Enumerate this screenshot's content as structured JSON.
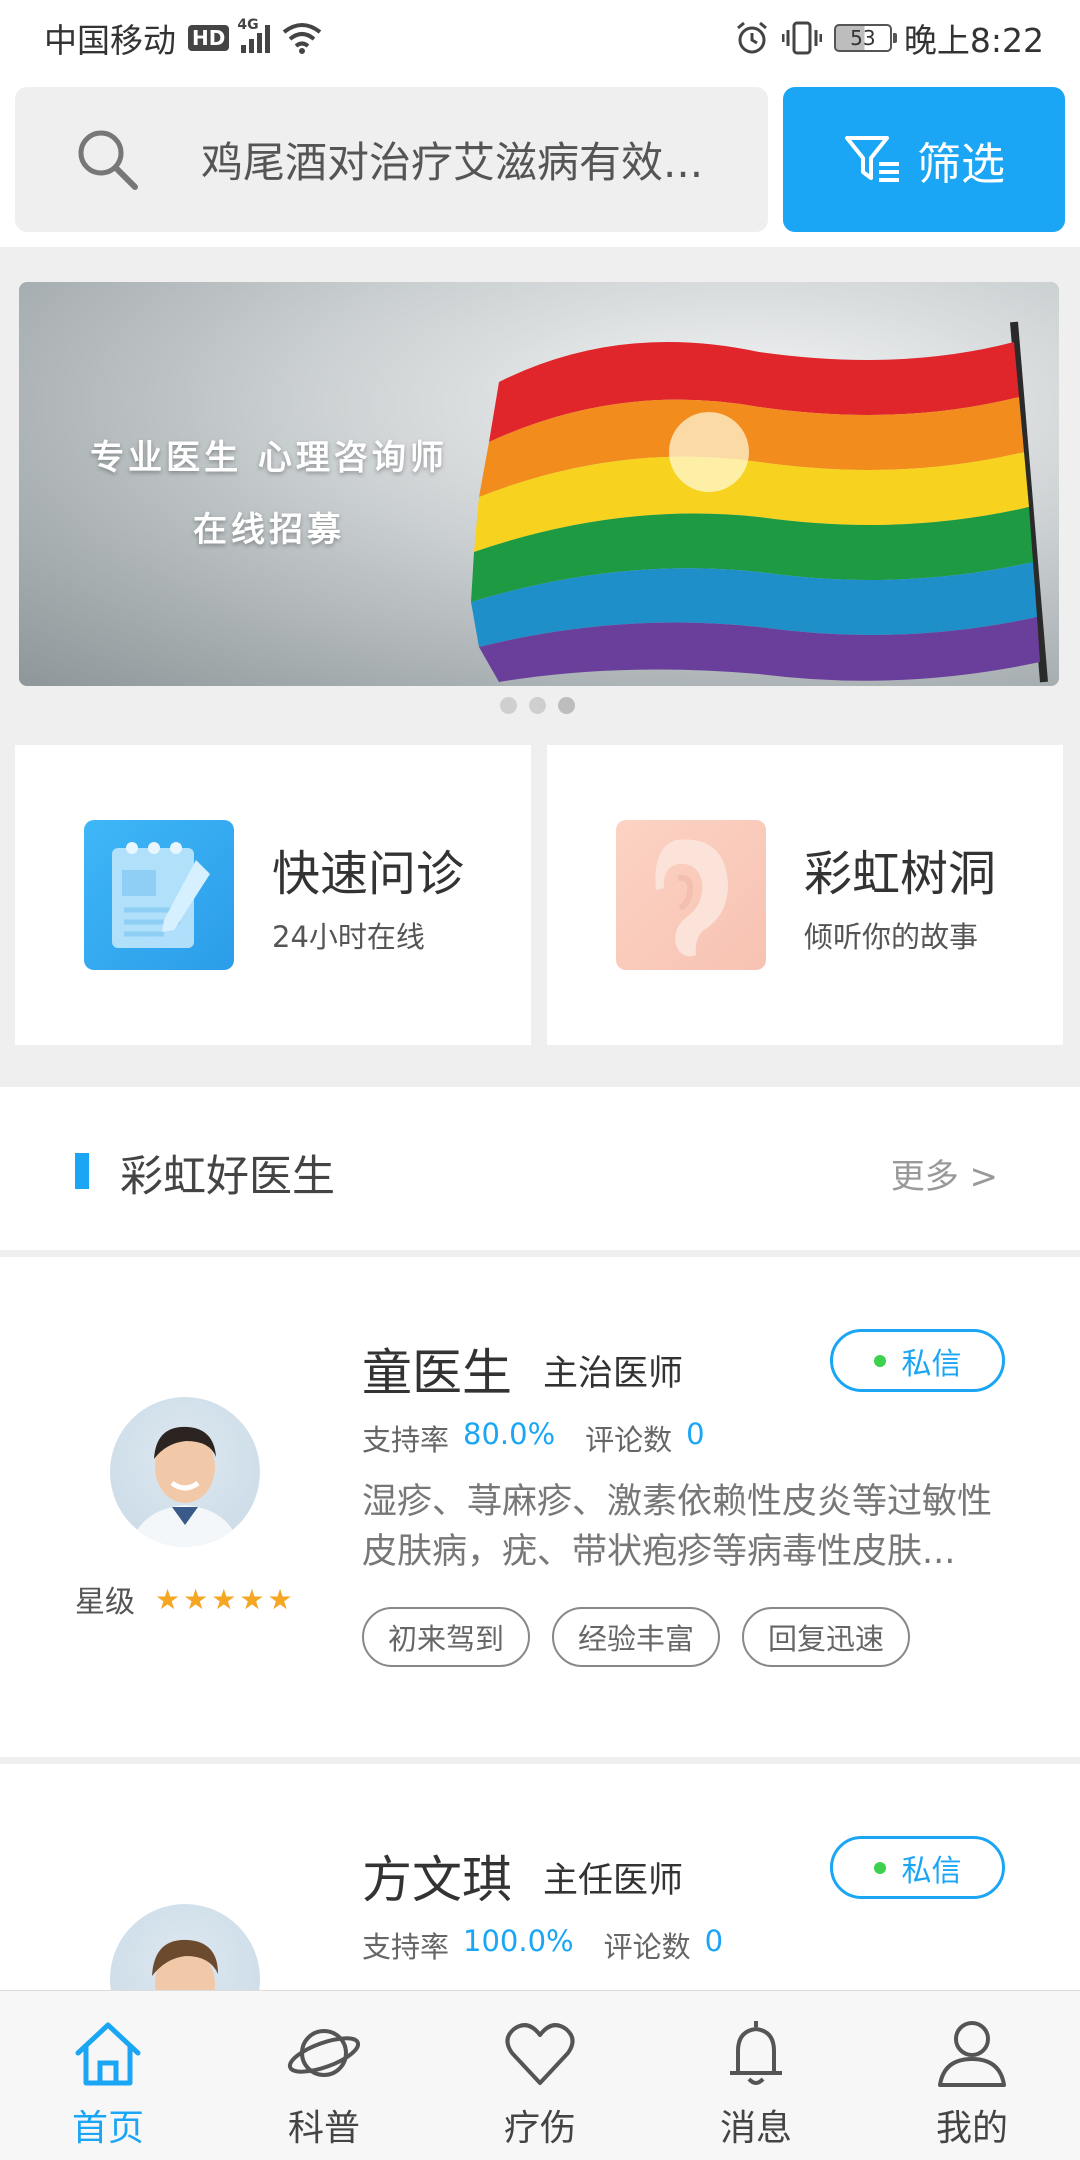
{
  "status_bar": {
    "carrier": "中国移动",
    "hd": "HD",
    "network": "4G",
    "battery": "53",
    "time": "晚上8:22"
  },
  "search": {
    "text": "鸡尾酒对治疗艾滋病有效...",
    "filter_label": "筛选"
  },
  "banner": {
    "line1": "专业医生 心理咨询师",
    "line2": "在线招募",
    "dots": 3,
    "active_dot": 2
  },
  "quick": [
    {
      "title": "快速问诊",
      "subtitle": "24小时在线"
    },
    {
      "title": "彩虹树洞",
      "subtitle": "倾听你的故事"
    }
  ],
  "section": {
    "title": "彩虹好医生",
    "more": "更多 >"
  },
  "doctors": [
    {
      "name": "童医生",
      "title": "主治医师",
      "message_label": "私信",
      "support_label": "支持率",
      "support_value": "80.0%",
      "comment_label": "评论数",
      "comment_value": "0",
      "description": "湿疹、荨麻疹、激素依赖性皮炎等过敏性皮肤病，疣、带状疱疹等病毒性皮肤...",
      "star_label": "星级",
      "stars": 5,
      "tags": [
        "初来驾到",
        "经验丰富",
        "回复迅速"
      ]
    },
    {
      "name": "方文琪",
      "title": "主任医师",
      "message_label": "私信",
      "support_label": "支持率",
      "support_value": "100.0%",
      "comment_label": "评论数",
      "comment_value": "0"
    }
  ],
  "tabs": [
    {
      "label": "首页",
      "icon": "home-icon",
      "active": true
    },
    {
      "label": "科普",
      "icon": "planet-icon",
      "active": false
    },
    {
      "label": "疗伤",
      "icon": "heart-icon",
      "active": false
    },
    {
      "label": "消息",
      "icon": "bell-icon",
      "active": false
    },
    {
      "label": "我的",
      "icon": "user-icon",
      "active": false
    }
  ],
  "colors": {
    "accent": "#1aa6f5",
    "online": "#3ed14e",
    "star": "#f5a623"
  }
}
